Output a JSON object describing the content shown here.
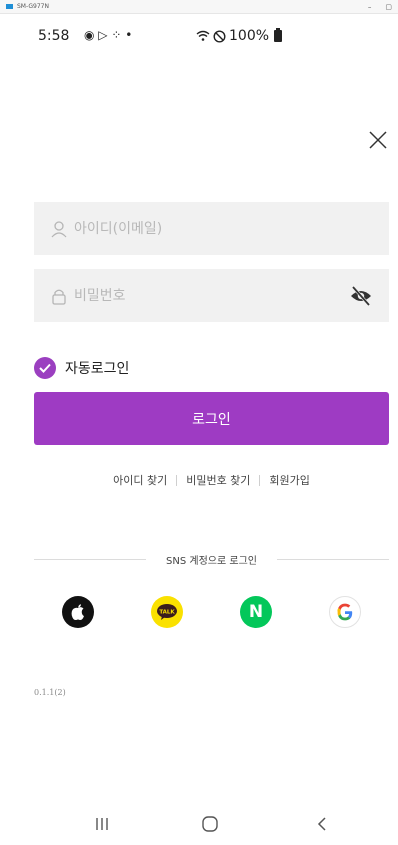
{
  "window": {
    "title": "SM-G977N"
  },
  "status_bar": {
    "time": "5:58",
    "left_icons": "◉ ▷ ⁘ •",
    "battery_pct": "100%"
  },
  "login_form": {
    "id_placeholder": "아이디(이메일)",
    "pw_placeholder": "비밀번호",
    "auto_login_label": "자동로그인",
    "auto_login_checked": true,
    "login_button_label": "로그인"
  },
  "links": {
    "find_id": "아이디 찾기",
    "find_pw": "비밀번호 찾기",
    "signup": "회원가입"
  },
  "sns": {
    "heading": "SNS 계정으로 로그인",
    "providers": [
      {
        "name": "apple",
        "icon": "apple-icon",
        "color": "#111111"
      },
      {
        "name": "kakao",
        "icon": "kakao-talk-icon",
        "label": "TALK",
        "color": "#fae100"
      },
      {
        "name": "naver",
        "icon": "naver-icon",
        "label": "N",
        "color": "#03c75a"
      },
      {
        "name": "google",
        "icon": "google-icon",
        "label": "G",
        "color": "#ffffff"
      }
    ]
  },
  "version": "0.1.1(2)",
  "colors": {
    "accent": "#9e3bc3",
    "field_bg": "#f1f1f1"
  }
}
